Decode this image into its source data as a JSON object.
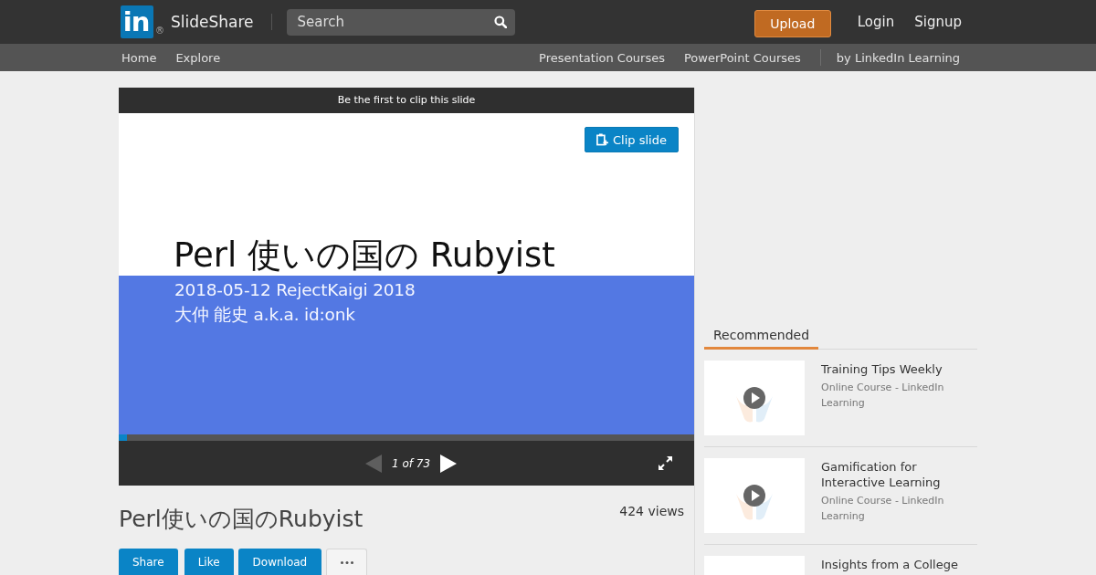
{
  "header": {
    "logo": {
      "text": "in",
      "mark": "®"
    },
    "brand": "SlideShare",
    "search": {
      "placeholder": "Search"
    },
    "actions": [
      {
        "label": "Upload",
        "kind": "button"
      },
      {
        "label": "Login",
        "kind": "link"
      },
      {
        "label": "Signup",
        "kind": "link"
      }
    ]
  },
  "subnav": {
    "left": [
      "Home",
      "Explore"
    ],
    "right": [
      "Presentation Courses",
      "PowerPoint Courses"
    ],
    "partner": "by LinkedIn Learning"
  },
  "player": {
    "clip_banner": "Be the first to clip this slide",
    "clip_button": "Clip slide",
    "slide": {
      "title": "Perl 使いの国の Rubyist",
      "lines": [
        "2018-05-12 RejectKaigi 2018",
        "大仲 能史 a.k.a. id:onk"
      ]
    },
    "progress": {
      "level": 0.014
    },
    "prev": {
      "disabled": true
    },
    "next": {
      "disabled": false
    },
    "page": "1 of 73"
  },
  "presentation": {
    "title": "Perl使いの国のRubyist",
    "views": "424 views",
    "buttons": [
      {
        "label": "Share",
        "kind": "primary"
      },
      {
        "label": "Like",
        "kind": "primary"
      },
      {
        "label": "Download",
        "kind": "primary"
      },
      {
        "kind": "more"
      }
    ]
  },
  "sidebar": {
    "tabs": [
      {
        "label": "Recommended",
        "selected": true
      }
    ],
    "items": [
      {
        "title": "Training Tips Weekly",
        "subtitle": "Online Course - LinkedIn Learning"
      },
      {
        "title": "Gamification for Interactive Learning",
        "subtitle": "Online Course - LinkedIn Learning"
      },
      {
        "title": "Insights from a College"
      }
    ]
  }
}
